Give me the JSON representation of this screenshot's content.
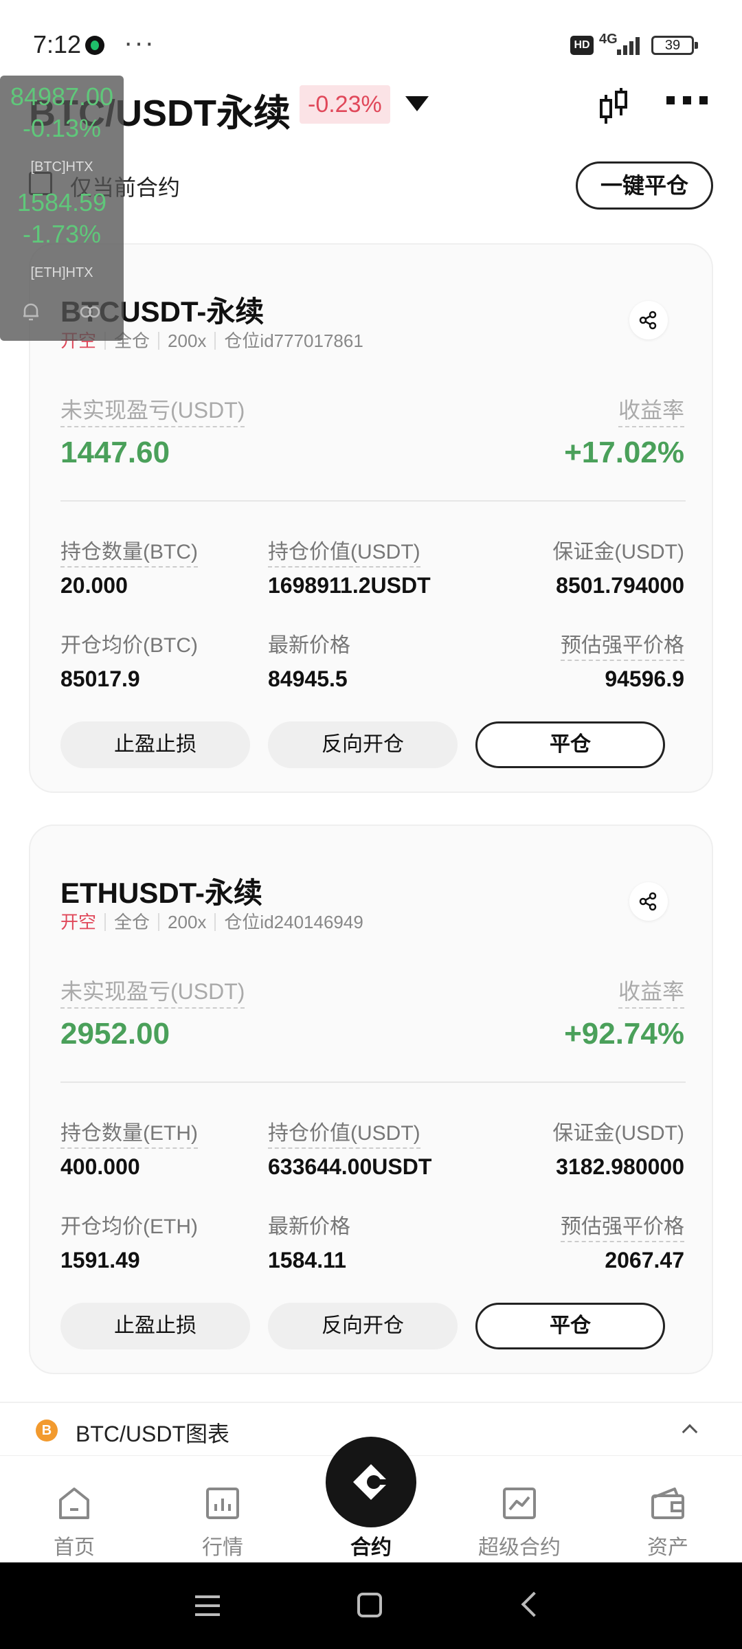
{
  "status_bar": {
    "time": "7:12",
    "dots": "···",
    "hd": "HD",
    "network": "4G",
    "battery": "39"
  },
  "header": {
    "pair_title": "BTC/USDT永续",
    "change": "-0.23%"
  },
  "filter": {
    "label": "仅当前合约",
    "close_all": "一键平仓"
  },
  "positions": [
    {
      "name": "BTCUSDT-永续",
      "side": "开空",
      "margin_mode": "全仓",
      "leverage": "200x",
      "position_id": "仓位id777017861",
      "pnl_label": "未实现盈亏(USDT)",
      "pnl_value": "1447.60",
      "roe_label": "收益率",
      "roe_value": "+17.02%",
      "qty_label": "持仓数量(BTC)",
      "qty_value": "20.000",
      "val_label": "持仓价值(USDT)",
      "val_value": "1698911.2USDT",
      "margin_label": "保证金(USDT)",
      "margin_value": "8501.794000",
      "entry_label": "开仓均价(BTC)",
      "entry_value": "85017.9",
      "last_label": "最新价格",
      "last_value": "84945.5",
      "liq_label": "预估强平价格",
      "liq_value": "94596.9",
      "btn_tpsl": "止盈止损",
      "btn_reverse": "反向开仓",
      "btn_close": "平仓"
    },
    {
      "name": "ETHUSDT-永续",
      "side": "开空",
      "margin_mode": "全仓",
      "leverage": "200x",
      "position_id": "仓位id240146949",
      "pnl_label": "未实现盈亏(USDT)",
      "pnl_value": "2952.00",
      "roe_label": "收益率",
      "roe_value": "+92.74%",
      "qty_label": "持仓数量(ETH)",
      "qty_value": "400.000",
      "val_label": "持仓价值(USDT)",
      "val_value": "633644.00USDT",
      "margin_label": "保证金(USDT)",
      "margin_value": "3182.980000",
      "entry_label": "开仓均价(ETH)",
      "entry_value": "1591.49",
      "last_label": "最新价格",
      "last_value": "1584.11",
      "liq_label": "预估强平价格",
      "liq_value": "2067.47",
      "btn_tpsl": "止盈止损",
      "btn_reverse": "反向开仓",
      "btn_close": "平仓"
    }
  ],
  "chart_section": {
    "coin": "B",
    "title": "BTC/USDT图表"
  },
  "nav": [
    {
      "label": "首页",
      "icon": "home-icon"
    },
    {
      "label": "行情",
      "icon": "market-icon"
    },
    {
      "label": "合约",
      "icon": "contract-icon",
      "active": true
    },
    {
      "label": "超级合约",
      "icon": "chart-line-icon"
    },
    {
      "label": "资产",
      "icon": "wallet-icon"
    }
  ],
  "ticker": {
    "btc_price": "84987.00",
    "btc_change": "-0.13%",
    "btc_label": "[BTC]HTX",
    "eth_price": "1584.59",
    "eth_change": "-1.73%",
    "eth_label": "[ETH]HTX"
  },
  "colors": {
    "profit": "#4aa05a",
    "short": "#e0485a",
    "change_bg": "#fbe3e6",
    "ticker_green": "#5fc87a"
  }
}
